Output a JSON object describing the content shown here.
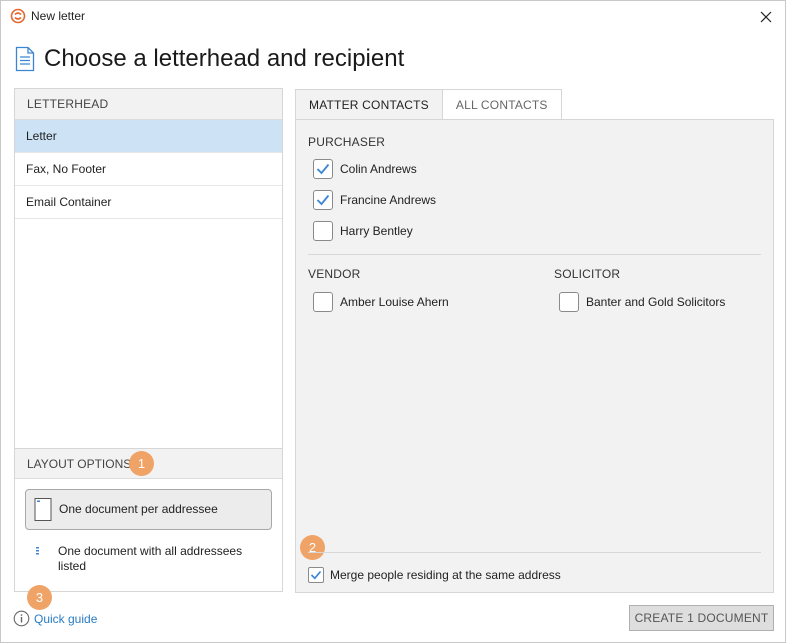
{
  "window": {
    "title": "New letter",
    "heading": "Choose a letterhead and recipient",
    "close_glyph": "✕"
  },
  "letterhead": {
    "header": "LETTERHEAD",
    "items": [
      {
        "label": "Letter",
        "selected": true
      },
      {
        "label": "Fax, No Footer",
        "selected": false
      },
      {
        "label": "Email Container",
        "selected": false
      }
    ]
  },
  "layout_options": {
    "header": "LAYOUT OPTIONS",
    "badge": "1",
    "option_per_addressee": "One document per addressee",
    "option_all_addressees": "One document with all addressees listed"
  },
  "tabs": [
    {
      "label": "MATTER CONTACTS",
      "active": true
    },
    {
      "label": "ALL CONTACTS",
      "active": false
    }
  ],
  "contacts": {
    "purchaser": {
      "label": "PURCHASER",
      "people": [
        {
          "name": "Colin Andrews",
          "checked": true
        },
        {
          "name": "Francine Andrews",
          "checked": true
        },
        {
          "name": "Harry Bentley",
          "checked": false
        }
      ]
    },
    "vendor": {
      "label": "VENDOR",
      "people": [
        {
          "name": "Amber Louise Ahern",
          "checked": false
        }
      ]
    },
    "solicitor": {
      "label": "SOLICITOR",
      "people": [
        {
          "name": "Banter and Gold Solicitors",
          "checked": false
        }
      ]
    }
  },
  "merge": {
    "badge": "2",
    "label": "Merge people residing at the same address",
    "checked": true
  },
  "footer": {
    "badge": "3",
    "quick_guide": "Quick guide",
    "info_glyph": "i",
    "create_button": "CREATE 1 DOCUMENT"
  },
  "colors": {
    "accent_link": "#2a7bc4",
    "selection": "#cde3f5",
    "badge": "#f0a366",
    "check": "#3a86d4",
    "logo": "#e5672e"
  },
  "icons": {
    "logo": "app-logo-icon",
    "document": "document-icon",
    "close": "close-icon",
    "check": "checkmark-icon",
    "info": "info-icon"
  }
}
